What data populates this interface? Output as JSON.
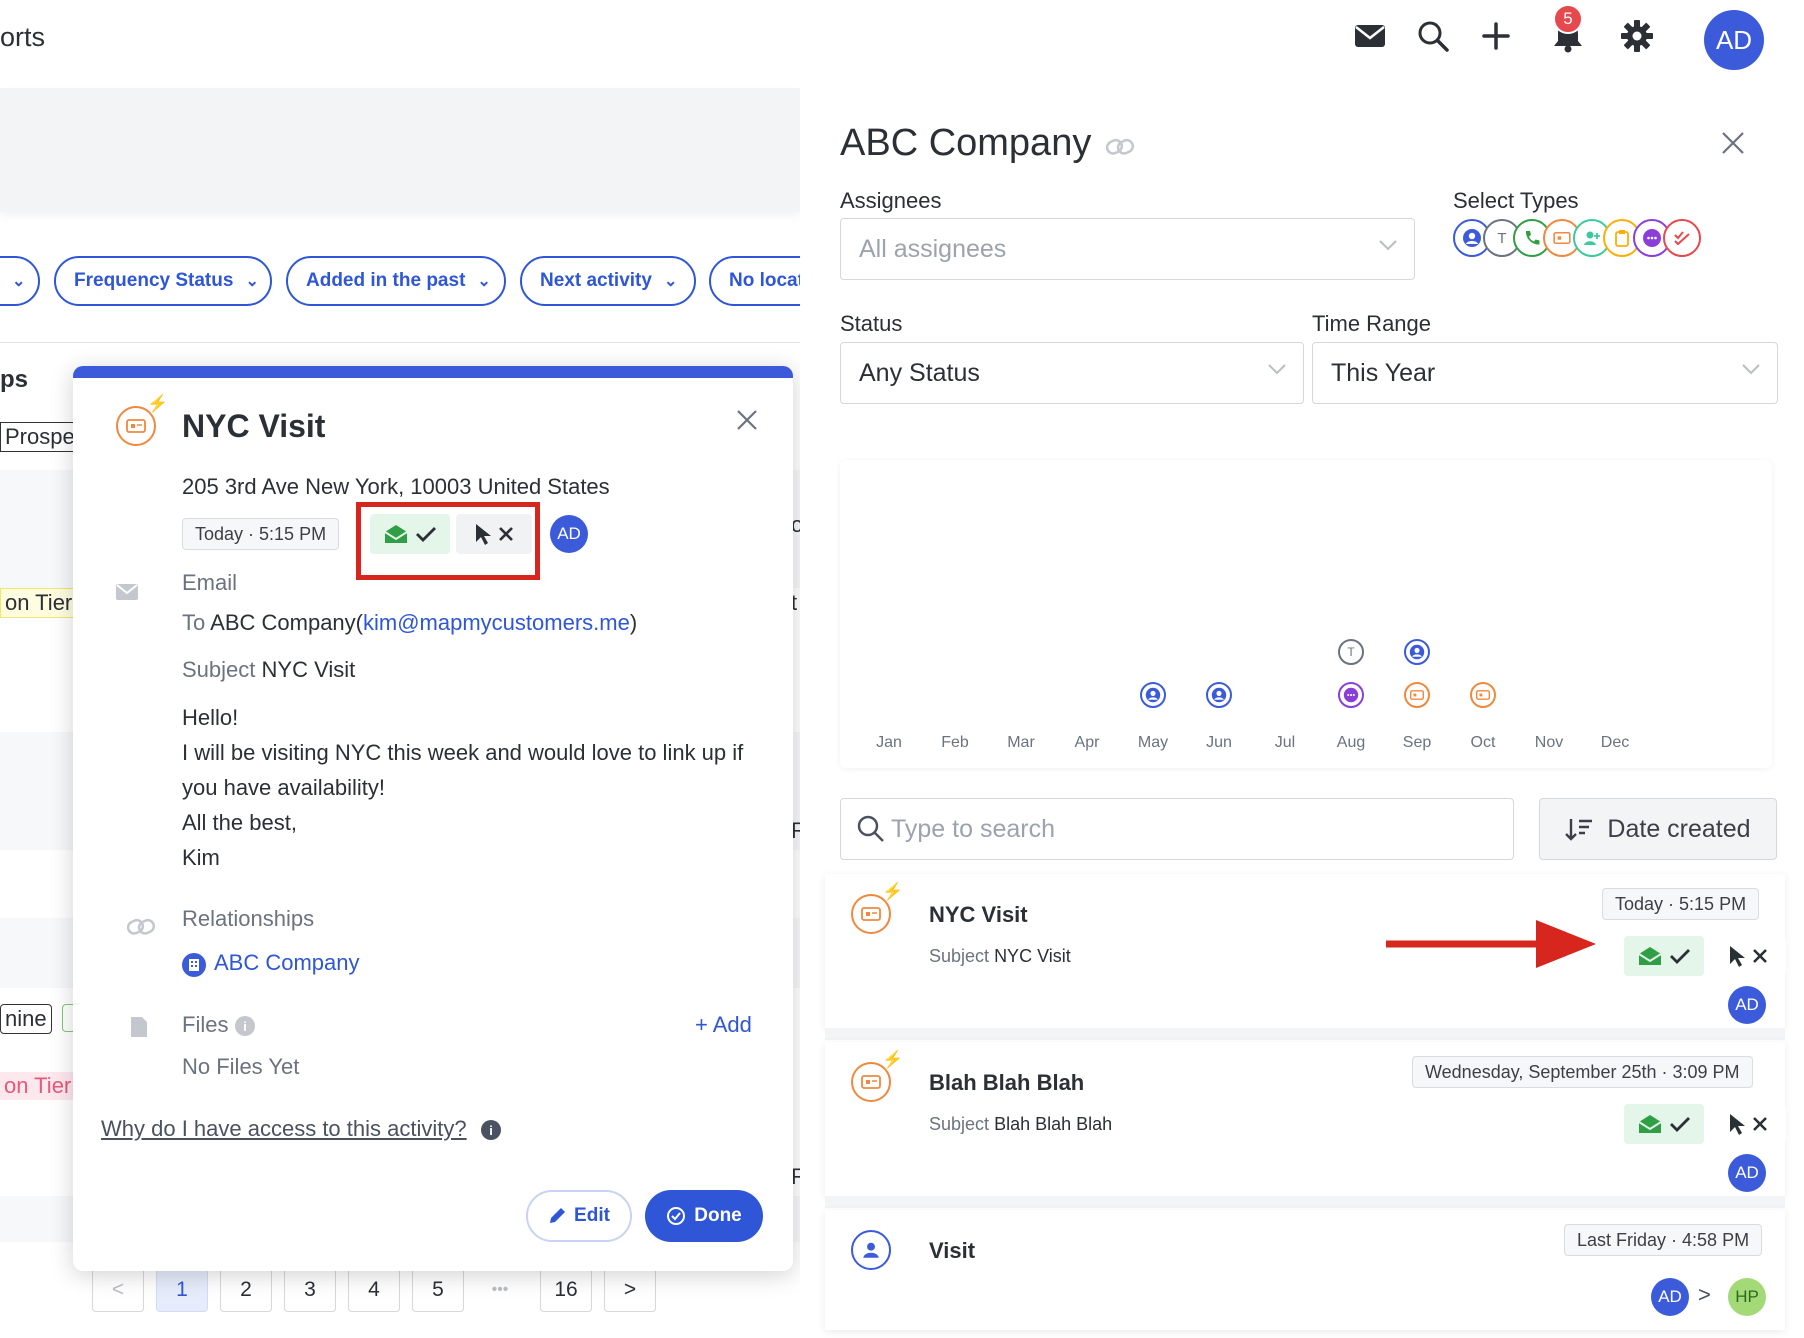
{
  "app": {
    "title_fragment": "orts",
    "notification_count": "5",
    "user_initials": "AD"
  },
  "filters": [
    {
      "label": ""
    },
    {
      "label": "Frequency Status"
    },
    {
      "label": "Added in the past"
    },
    {
      "label": "Next activity"
    },
    {
      "label": "No locat"
    }
  ],
  "background_fragments": {
    "heading": "ps",
    "row1": "Prospec",
    "row2": "on Tier",
    "row3": "nine",
    "row4": "on Tier",
    "edge1": "o",
    "edge2": "t",
    "edge3": "R",
    "edge4": "R"
  },
  "pagination": {
    "prev": "<",
    "pages": [
      "1",
      "2",
      "3",
      "4",
      "5"
    ],
    "ellipsis": "•••",
    "last": "16",
    "next": ">",
    "current": "1"
  },
  "activity_popup": {
    "title": "NYC Visit",
    "address": "205 3rd Ave New York, 10003 United States",
    "time": "Today · 5:15 PM",
    "assignee_initials": "AD",
    "email_label": "Email",
    "to_label": "To",
    "to_company": "ABC Company",
    "to_open_paren": "(",
    "to_email": "kim@mapmycustomers.me",
    "to_close_paren": ")",
    "subject_label": "Subject",
    "subject_value": "NYC Visit",
    "body_lines": [
      "Hello!",
      "I will be visiting NYC this week and would love to link up if",
      "you have availability!",
      "All the best,",
      "Kim"
    ],
    "relationships_label": "Relationships",
    "relationship_company": "ABC Company",
    "files_label": "Files",
    "add_label": "+ Add",
    "no_files": "No Files Yet",
    "access_link": "Why do I have access to this activity?",
    "edit_label": "Edit",
    "done_label": "Done"
  },
  "right_panel": {
    "title": "ABC Company",
    "assignees_label": "Assignees",
    "assignees_placeholder": "All assignees",
    "select_types_label": "Select Types",
    "status_label": "Status",
    "status_value": "Any Status",
    "time_range_label": "Time Range",
    "time_range_value": "This Year",
    "search_placeholder": "Type to search",
    "sort_label": "Date created",
    "activities": [
      {
        "title": "NYC Visit",
        "subject_label": "Subject",
        "subject": "NYC Visit",
        "time": "Today · 5:15 PM",
        "assignee": "AD"
      },
      {
        "title": "Blah Blah Blah",
        "subject_label": "Subject",
        "subject": "Blah Blah Blah",
        "time": "Wednesday, September 25th · 3:09 PM",
        "assignee": "AD"
      },
      {
        "title": "Visit",
        "time": "Last Friday · 4:58 PM",
        "assignee": "AD",
        "second_assignee": "HP",
        "chevron": ">"
      }
    ]
  },
  "type_icons": [
    {
      "icon": "person-icon",
      "color": "#3b5bdb"
    },
    {
      "icon": "text-T-icon",
      "label": "T",
      "color": "#6b7280"
    },
    {
      "icon": "phone-icon",
      "color": "#2f9e44"
    },
    {
      "icon": "email-visit-icon",
      "color": "#f0893e"
    },
    {
      "icon": "add-person-icon",
      "color": "#3bc9a0"
    },
    {
      "icon": "clipboard-icon",
      "color": "#fab005"
    },
    {
      "icon": "chat-icon",
      "color": "#8b3fd9"
    },
    {
      "icon": "check-task-icon",
      "color": "#e5484d"
    }
  ],
  "chart_data": {
    "type": "scatter",
    "categories": [
      "Jan",
      "Feb",
      "Mar",
      "Apr",
      "May",
      "Jun",
      "Jul",
      "Aug",
      "Sep",
      "Oct",
      "Nov",
      "Dec"
    ],
    "markers": [
      {
        "month": "May",
        "stack": 1,
        "icon": "person-icon",
        "color": "#3b5bdb"
      },
      {
        "month": "Jun",
        "stack": 1,
        "icon": "person-icon",
        "color": "#3b5bdb"
      },
      {
        "month": "Aug",
        "stack": 1,
        "icon": "chat-icon",
        "color": "#8b3fd9"
      },
      {
        "month": "Aug",
        "stack": 2,
        "icon": "text-T-icon",
        "label": "T",
        "color": "#6b7280"
      },
      {
        "month": "Sep",
        "stack": 1,
        "icon": "email-visit-icon",
        "color": "#f0893e"
      },
      {
        "month": "Sep",
        "stack": 2,
        "icon": "person-icon",
        "color": "#3b5bdb"
      },
      {
        "month": "Oct",
        "stack": 1,
        "icon": "email-visit-icon",
        "color": "#f0893e"
      }
    ]
  },
  "colors": {
    "accent": "#2e56d6",
    "highlight_box": "#d7261e",
    "arrow": "#d7261e",
    "read_green": "#2f9e44"
  }
}
